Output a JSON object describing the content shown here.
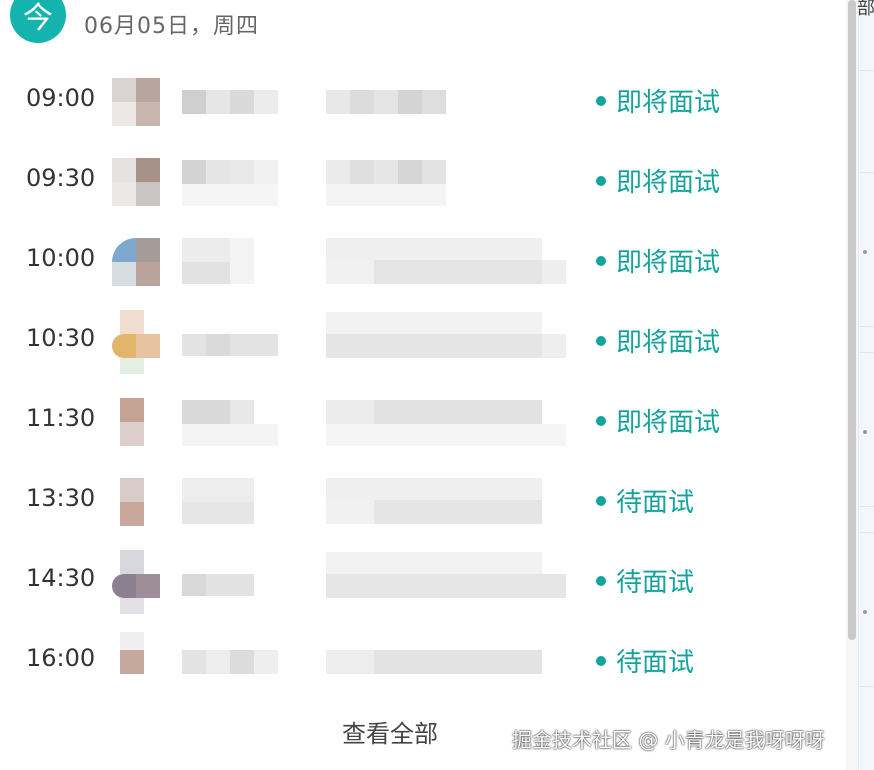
{
  "header": {
    "badge": "今",
    "date": "06月05日，周四"
  },
  "interviews": [
    {
      "time": "09:00",
      "status": "即将面试"
    },
    {
      "time": "09:30",
      "status": "即将面试"
    },
    {
      "time": "10:00",
      "status": "即将面试"
    },
    {
      "time": "10:30",
      "status": "即将面试"
    },
    {
      "time": "11:30",
      "status": "即将面试"
    },
    {
      "time": "13:30",
      "status": "待面试"
    },
    {
      "time": "14:30",
      "status": "待面试"
    },
    {
      "time": "16:00",
      "status": "待面试"
    }
  ],
  "footer": {
    "view_all": "查看全部"
  },
  "watermark": "掘金技术社区 @ 小青龙是我呀呀呀",
  "right_edge_text": "部",
  "colors": {
    "accent": "#15b3ad",
    "status_text": "#15a39d"
  }
}
